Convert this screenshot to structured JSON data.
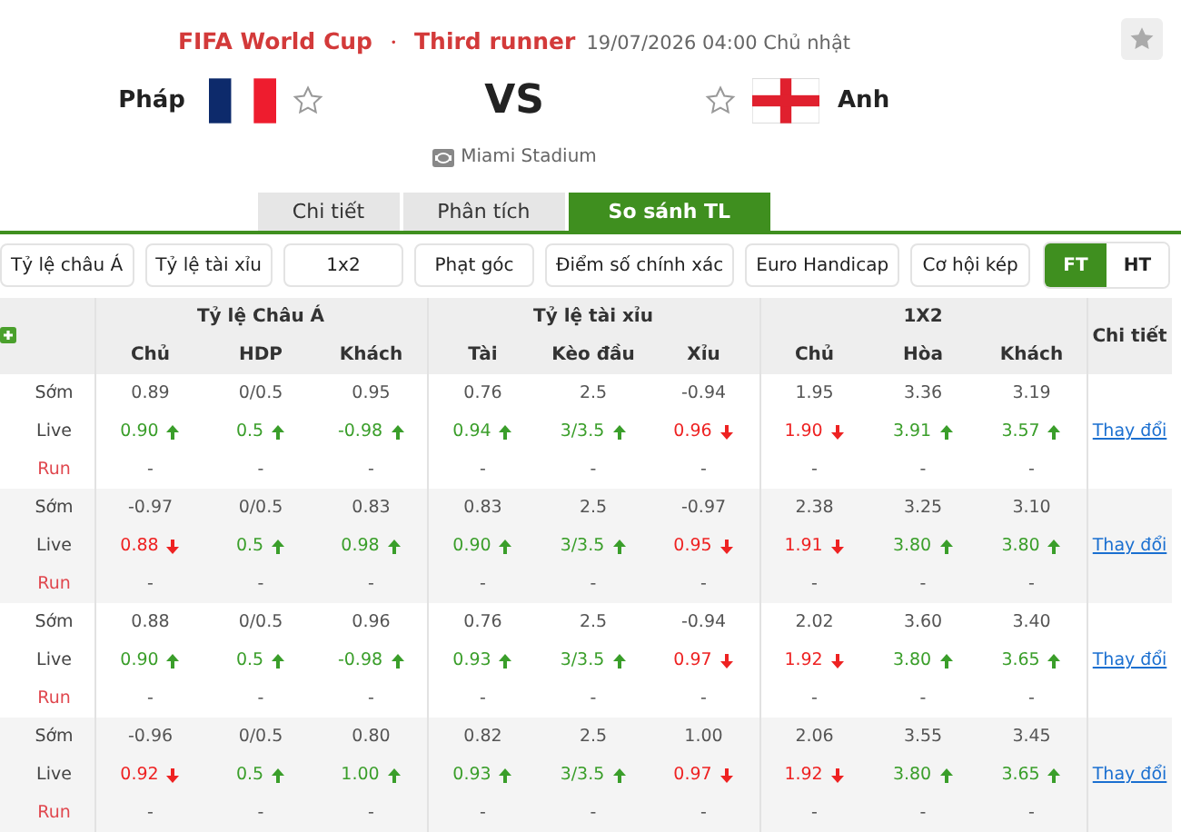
{
  "match": {
    "competition": "FIFA World Cup",
    "separator": "・",
    "round": "Third runner",
    "datetime": "19/07/2026 04:00 Chủ nhật",
    "home": {
      "name": "Pháp"
    },
    "away": {
      "name": "Anh"
    },
    "vs": "VS",
    "stadium": "Miami Stadium"
  },
  "tabs": [
    {
      "label": "Chi tiết",
      "selected": false
    },
    {
      "label": "Phân tích",
      "selected": false
    },
    {
      "label": "So sánh TL",
      "selected": true
    }
  ],
  "filters": [
    "Tỷ lệ châu Á",
    "Tỷ lệ tài xỉu",
    "1x2",
    "Phạt góc",
    "Điểm số chính xác",
    "Euro Handicap",
    "Cơ hội kép"
  ],
  "period_toggle": [
    {
      "label": "FT",
      "selected": true
    },
    {
      "label": "HT",
      "selected": false
    }
  ],
  "table": {
    "groups": [
      "Tỷ lệ Châu Á",
      "Tỷ lệ tài xỉu",
      "1X2"
    ],
    "detail_header": "Chi tiết",
    "columns": [
      "Chủ",
      "HDP",
      "Khách",
      "Tài",
      "Kèo đầu",
      "Xỉu",
      "Chủ",
      "Hòa",
      "Khách"
    ],
    "blocks": [
      {
        "detail_link": "Thay đổi",
        "rows": [
          {
            "label": "Sớm",
            "kind": "early",
            "cells": [
              {
                "value": "0.89",
                "rising": false,
                "falling": false
              },
              {
                "value": "0/0.5",
                "rising": false,
                "falling": false
              },
              {
                "value": "0.95",
                "rising": false,
                "falling": false
              },
              {
                "value": "0.76",
                "rising": false,
                "falling": false
              },
              {
                "value": "2.5",
                "rising": false,
                "falling": false
              },
              {
                "value": "-0.94",
                "rising": false,
                "falling": false
              },
              {
                "value": "1.95",
                "rising": false,
                "falling": false
              },
              {
                "value": "3.36",
                "rising": false,
                "falling": false
              },
              {
                "value": "3.19",
                "rising": false,
                "falling": false
              }
            ]
          },
          {
            "label": "Live",
            "kind": "live",
            "cells": [
              {
                "value": "0.90",
                "rising": true,
                "falling": false
              },
              {
                "value": "0.5",
                "rising": true,
                "falling": false
              },
              {
                "value": "-0.98",
                "rising": true,
                "falling": false
              },
              {
                "value": "0.94",
                "rising": true,
                "falling": false
              },
              {
                "value": "3/3.5",
                "rising": true,
                "falling": false
              },
              {
                "value": "0.96",
                "rising": false,
                "falling": true
              },
              {
                "value": "1.90",
                "rising": false,
                "falling": true
              },
              {
                "value": "3.91",
                "rising": true,
                "falling": false
              },
              {
                "value": "3.57",
                "rising": true,
                "falling": false
              }
            ]
          },
          {
            "label": "Run",
            "kind": "run",
            "cells": [
              {
                "value": "-",
                "rising": false,
                "falling": false
              },
              {
                "value": "-",
                "rising": false,
                "falling": false
              },
              {
                "value": "-",
                "rising": false,
                "falling": false
              },
              {
                "value": "-",
                "rising": false,
                "falling": false
              },
              {
                "value": "-",
                "rising": false,
                "falling": false
              },
              {
                "value": "-",
                "rising": false,
                "falling": false
              },
              {
                "value": "-",
                "rising": false,
                "falling": false
              },
              {
                "value": "-",
                "rising": false,
                "falling": false
              },
              {
                "value": "-",
                "rising": false,
                "falling": false
              }
            ]
          }
        ]
      },
      {
        "detail_link": "Thay đổi",
        "rows": [
          {
            "label": "Sớm",
            "kind": "early",
            "cells": [
              {
                "value": "-0.97",
                "rising": false,
                "falling": false
              },
              {
                "value": "0/0.5",
                "rising": false,
                "falling": false
              },
              {
                "value": "0.83",
                "rising": false,
                "falling": false
              },
              {
                "value": "0.83",
                "rising": false,
                "falling": false
              },
              {
                "value": "2.5",
                "rising": false,
                "falling": false
              },
              {
                "value": "-0.97",
                "rising": false,
                "falling": false
              },
              {
                "value": "2.38",
                "rising": false,
                "falling": false
              },
              {
                "value": "3.25",
                "rising": false,
                "falling": false
              },
              {
                "value": "3.10",
                "rising": false,
                "falling": false
              }
            ]
          },
          {
            "label": "Live",
            "kind": "live",
            "cells": [
              {
                "value": "0.88",
                "rising": false,
                "falling": true
              },
              {
                "value": "0.5",
                "rising": true,
                "falling": false
              },
              {
                "value": "0.98",
                "rising": true,
                "falling": false
              },
              {
                "value": "0.90",
                "rising": true,
                "falling": false
              },
              {
                "value": "3/3.5",
                "rising": true,
                "falling": false
              },
              {
                "value": "0.95",
                "rising": false,
                "falling": true
              },
              {
                "value": "1.91",
                "rising": false,
                "falling": true
              },
              {
                "value": "3.80",
                "rising": true,
                "falling": false
              },
              {
                "value": "3.80",
                "rising": true,
                "falling": false
              }
            ]
          },
          {
            "label": "Run",
            "kind": "run",
            "cells": [
              {
                "value": "-",
                "rising": false,
                "falling": false
              },
              {
                "value": "-",
                "rising": false,
                "falling": false
              },
              {
                "value": "-",
                "rising": false,
                "falling": false
              },
              {
                "value": "-",
                "rising": false,
                "falling": false
              },
              {
                "value": "-",
                "rising": false,
                "falling": false
              },
              {
                "value": "-",
                "rising": false,
                "falling": false
              },
              {
                "value": "-",
                "rising": false,
                "falling": false
              },
              {
                "value": "-",
                "rising": false,
                "falling": false
              },
              {
                "value": "-",
                "rising": false,
                "falling": false
              }
            ]
          }
        ]
      },
      {
        "detail_link": "Thay đổi",
        "rows": [
          {
            "label": "Sớm",
            "kind": "early",
            "cells": [
              {
                "value": "0.88",
                "rising": false,
                "falling": false
              },
              {
                "value": "0/0.5",
                "rising": false,
                "falling": false
              },
              {
                "value": "0.96",
                "rising": false,
                "falling": false
              },
              {
                "value": "0.76",
                "rising": false,
                "falling": false
              },
              {
                "value": "2.5",
                "rising": false,
                "falling": false
              },
              {
                "value": "-0.94",
                "rising": false,
                "falling": false
              },
              {
                "value": "2.02",
                "rising": false,
                "falling": false
              },
              {
                "value": "3.60",
                "rising": false,
                "falling": false
              },
              {
                "value": "3.40",
                "rising": false,
                "falling": false
              }
            ]
          },
          {
            "label": "Live",
            "kind": "live",
            "cells": [
              {
                "value": "0.90",
                "rising": true,
                "falling": false
              },
              {
                "value": "0.5",
                "rising": true,
                "falling": false
              },
              {
                "value": "-0.98",
                "rising": true,
                "falling": false
              },
              {
                "value": "0.93",
                "rising": true,
                "falling": false
              },
              {
                "value": "3/3.5",
                "rising": true,
                "falling": false
              },
              {
                "value": "0.97",
                "rising": false,
                "falling": true
              },
              {
                "value": "1.92",
                "rising": false,
                "falling": true
              },
              {
                "value": "3.80",
                "rising": true,
                "falling": false
              },
              {
                "value": "3.65",
                "rising": true,
                "falling": false
              }
            ]
          },
          {
            "label": "Run",
            "kind": "run",
            "cells": [
              {
                "value": "-",
                "rising": false,
                "falling": false
              },
              {
                "value": "-",
                "rising": false,
                "falling": false
              },
              {
                "value": "-",
                "rising": false,
                "falling": false
              },
              {
                "value": "-",
                "rising": false,
                "falling": false
              },
              {
                "value": "-",
                "rising": false,
                "falling": false
              },
              {
                "value": "-",
                "rising": false,
                "falling": false
              },
              {
                "value": "-",
                "rising": false,
                "falling": false
              },
              {
                "value": "-",
                "rising": false,
                "falling": false
              },
              {
                "value": "-",
                "rising": false,
                "falling": false
              }
            ]
          }
        ]
      },
      {
        "detail_link": "Thay đổi",
        "rows": [
          {
            "label": "Sớm",
            "kind": "early",
            "cells": [
              {
                "value": "-0.96",
                "rising": false,
                "falling": false
              },
              {
                "value": "0/0.5",
                "rising": false,
                "falling": false
              },
              {
                "value": "0.80",
                "rising": false,
                "falling": false
              },
              {
                "value": "0.82",
                "rising": false,
                "falling": false
              },
              {
                "value": "2.5",
                "rising": false,
                "falling": false
              },
              {
                "value": "1.00",
                "rising": false,
                "falling": false
              },
              {
                "value": "2.06",
                "rising": false,
                "falling": false
              },
              {
                "value": "3.55",
                "rising": false,
                "falling": false
              },
              {
                "value": "3.45",
                "rising": false,
                "falling": false
              }
            ]
          },
          {
            "label": "Live",
            "kind": "live",
            "cells": [
              {
                "value": "0.92",
                "rising": false,
                "falling": true
              },
              {
                "value": "0.5",
                "rising": true,
                "falling": false
              },
              {
                "value": "1.00",
                "rising": true,
                "falling": false
              },
              {
                "value": "0.93",
                "rising": true,
                "falling": false
              },
              {
                "value": "3/3.5",
                "rising": true,
                "falling": false
              },
              {
                "value": "0.97",
                "rising": false,
                "falling": true
              },
              {
                "value": "1.92",
                "rising": false,
                "falling": true
              },
              {
                "value": "3.80",
                "rising": true,
                "falling": false
              },
              {
                "value": "3.65",
                "rising": true,
                "falling": false
              }
            ]
          },
          {
            "label": "Run",
            "kind": "run",
            "cells": [
              {
                "value": "-",
                "rising": false,
                "falling": false
              },
              {
                "value": "-",
                "rising": false,
                "falling": false
              },
              {
                "value": "-",
                "rising": false,
                "falling": false
              },
              {
                "value": "-",
                "rising": false,
                "falling": false
              },
              {
                "value": "-",
                "rising": false,
                "falling": false
              },
              {
                "value": "-",
                "rising": false,
                "falling": false
              },
              {
                "value": "-",
                "rising": false,
                "falling": false
              },
              {
                "value": "-",
                "rising": false,
                "falling": false
              },
              {
                "value": "-",
                "rising": false,
                "falling": false
              }
            ]
          }
        ]
      }
    ]
  }
}
